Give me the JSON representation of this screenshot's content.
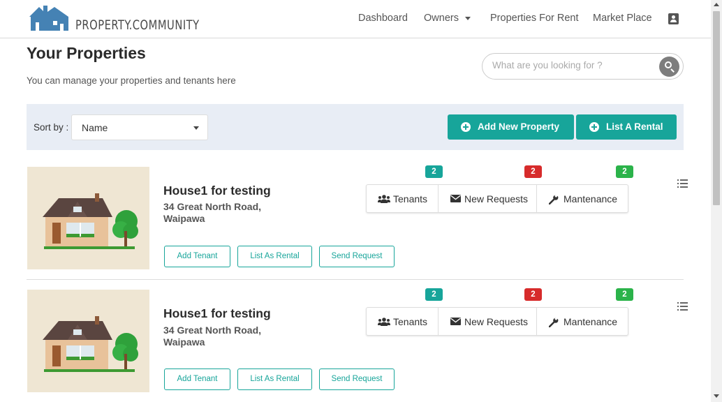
{
  "brand": {
    "name": "PROPERTY.COMMUNITY",
    "colors": {
      "teal": "#17a59a",
      "logo_blue": "#4582b4",
      "badge_red": "#d72b2b",
      "badge_green": "#2bb34a"
    }
  },
  "nav": {
    "items": [
      "Dashboard",
      "Owners",
      "Properties For Rent",
      "Market Place"
    ],
    "user_icon": "user-badge-icon"
  },
  "header": {
    "title": "Your Properties",
    "subtitle": "You can manage your properties and tenants here"
  },
  "search": {
    "placeholder": "What are you looking for ?",
    "icon": "search-icon"
  },
  "toolbar": {
    "sort_label": "Sort by :",
    "sort_value": "Name",
    "add_property": "Add New Property",
    "list_rental": "List A Rental"
  },
  "properties": [
    {
      "title": "House1 for testing",
      "address": "34 Great North Road, Waipawa",
      "stats": [
        {
          "label": "Tenants",
          "count": "2",
          "icon": "users-icon"
        },
        {
          "label": "New Requests",
          "count": "2",
          "icon": "envelope-icon"
        },
        {
          "label": "Mantenance",
          "count": "2",
          "icon": "wrench-icon"
        }
      ],
      "actions": [
        "Add Tenant",
        "List As Rental",
        "Send Request"
      ]
    },
    {
      "title": "House1 for testing",
      "address": "34 Great North Road, Waipawa",
      "stats": [
        {
          "label": "Tenants",
          "count": "2",
          "icon": "users-icon"
        },
        {
          "label": "New Requests",
          "count": "2",
          "icon": "envelope-icon"
        },
        {
          "label": "Mantenance",
          "count": "2",
          "icon": "wrench-icon"
        }
      ],
      "actions": [
        "Add Tenant",
        "List As Rental",
        "Send Request"
      ]
    }
  ]
}
